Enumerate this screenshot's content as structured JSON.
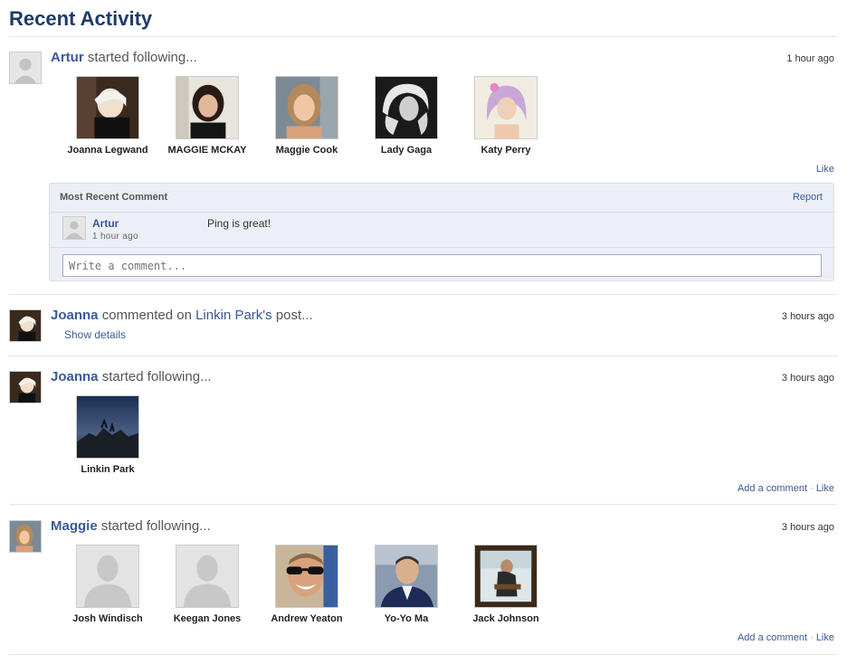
{
  "page": {
    "title": "Recent Activity"
  },
  "activities": [
    {
      "user": "Artur",
      "action": "started following...",
      "time": "1 hour ago",
      "followed": [
        "Joanna Legwand",
        "MAGGIE MCKAY",
        "Maggie Cook",
        "Lady Gaga",
        "Katy Perry"
      ],
      "like_label": "Like",
      "comment_section": {
        "header": "Most Recent Comment",
        "report_label": "Report",
        "comment": {
          "author": "Artur",
          "time": "1 hour ago",
          "text": "Ping is great!"
        },
        "input_placeholder": "Write a comment..."
      }
    },
    {
      "user": "Joanna",
      "action_part1": "commented on",
      "target": "Linkin Park's",
      "action_part2": "post...",
      "time": "3 hours ago",
      "details_label": "Show details"
    },
    {
      "user": "Joanna",
      "action": "started following...",
      "time": "3 hours ago",
      "followed": [
        "Linkin Park"
      ],
      "add_comment_label": "Add a comment",
      "separator": "·",
      "like_label": "Like"
    },
    {
      "user": "Maggie",
      "action": "started following...",
      "time": "3 hours ago",
      "followed": [
        "Josh Windisch",
        "Keegan Jones",
        "Andrew Yeaton",
        "Yo-Yo Ma",
        "Jack Johnson"
      ],
      "add_comment_label": "Add a comment",
      "separator": "·",
      "like_label": "Like"
    }
  ]
}
